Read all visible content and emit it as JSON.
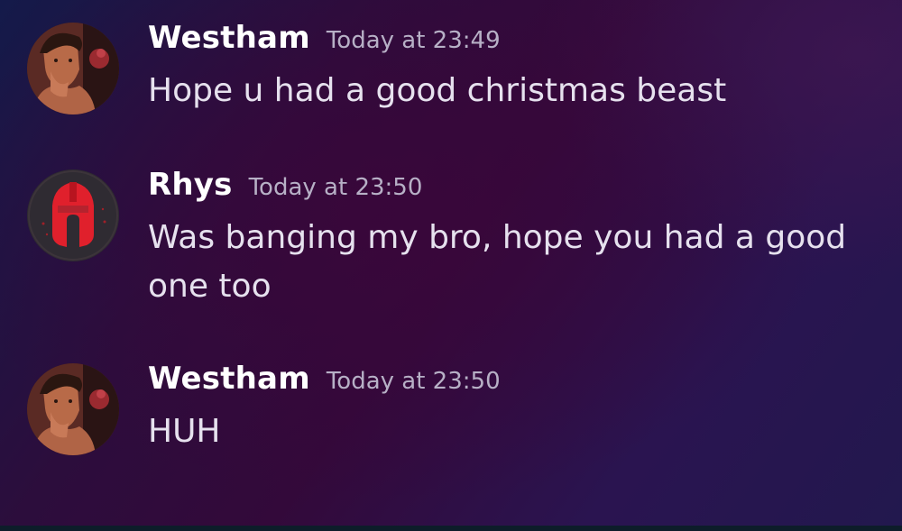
{
  "messages": [
    {
      "author": "Westham",
      "timestamp": "Today at 23:49",
      "text": "Hope u had a good christmas beast",
      "avatar_icon": "man-portrait-avatar"
    },
    {
      "author": "Rhys",
      "timestamp": "Today at 23:50",
      "text": "Was banging my bro, hope you had a good one too",
      "avatar_icon": "spartan-helmet-avatar"
    },
    {
      "author": "Westham",
      "timestamp": "Today at 23:50",
      "text": "HUH",
      "avatar_icon": "man-portrait-avatar"
    }
  ],
  "colors": {
    "username": "#ffffff",
    "timestamp": "#b7b0c6",
    "message_text": "#e6e1ee",
    "helmet_red": "#e0202c"
  }
}
